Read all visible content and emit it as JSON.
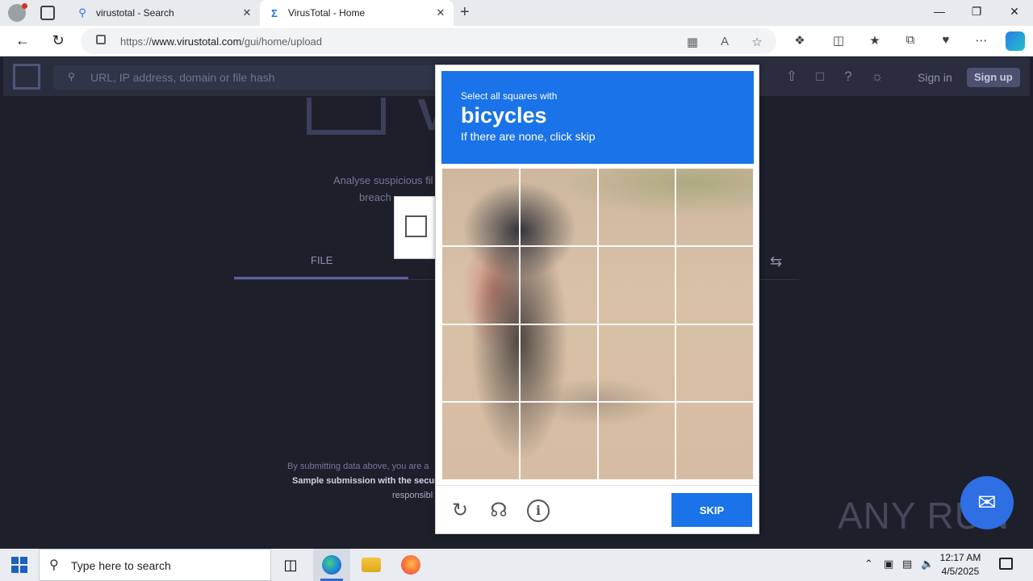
{
  "browser": {
    "tabs": [
      {
        "title": "virustotal - Search",
        "icon": "search-icon"
      },
      {
        "title": "VirusTotal - Home",
        "icon": "virustotal-icon"
      }
    ],
    "url_prefix": "https://",
    "url_host": "www.virustotal.com",
    "url_path": "/gui/home/upload"
  },
  "virustotal": {
    "search_placeholder": "URL, IP address, domain or file hash",
    "sign_in": "Sign in",
    "sign_up": "Sign up",
    "hero_letter": "V",
    "analyse_text": "Analyse suspicious fil",
    "breach_text": "breach",
    "file_tab": "FILE",
    "terms_line1": "By submitting data above, you are a",
    "terms_line2": "Sample submission with the secur",
    "terms_line3": "responsibl"
  },
  "captcha": {
    "instruction": "Select all squares with",
    "target": "bicycles",
    "hint": "If there are none, click skip",
    "skip_label": "SKIP",
    "grid_rows": 4,
    "grid_cols": 4
  },
  "watermark": {
    "text": "ANY RUN"
  },
  "taskbar": {
    "search_placeholder": "Type here to search",
    "time": "12:17 AM",
    "date": "4/5/2025"
  }
}
